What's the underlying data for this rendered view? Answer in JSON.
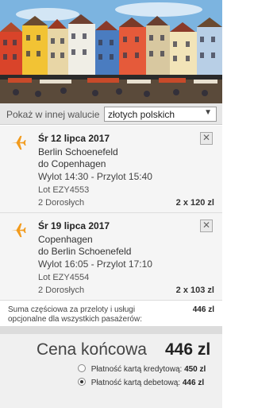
{
  "currency": {
    "label": "Pokaż w innej walucie",
    "selected": "złotych polskich"
  },
  "flights": [
    {
      "date": "Śr 12 lipca 2017",
      "from": "Berlin Schoenefeld",
      "to": "do Copenhagen",
      "times": "Wylot 14:30 - Przylot 15:40",
      "flight_no": "Lot EZY4553",
      "passengers": "2 Dorosłych",
      "price": "2 x 120 zl"
    },
    {
      "date": "Śr 19 lipca 2017",
      "from": "Copenhagen",
      "to": "do Berlin Schoenefeld",
      "times": "Wylot 16:05 - Przylot 17:10",
      "flight_no": "Lot EZY4554",
      "passengers": "2 Dorosłych",
      "price": "2 x 103 zl"
    }
  ],
  "close_glyph": "✕",
  "subtotal": {
    "label": "Suma częściowa za przeloty i usługi opcjonalne dla wszystkich pasażerów:",
    "value": "446 zl"
  },
  "final": {
    "label": "Cena końcowa",
    "value": "446 zl"
  },
  "payment_options": [
    {
      "label": "Płatność kartą kredytową:",
      "value": "450 zl",
      "selected": false
    },
    {
      "label": "Płatność kartą debetową:",
      "value": "446 zl",
      "selected": true
    }
  ],
  "colors": {
    "accent": "#f29b1d",
    "panel": "#f5f5f5",
    "bar": "#e6e6e6"
  }
}
